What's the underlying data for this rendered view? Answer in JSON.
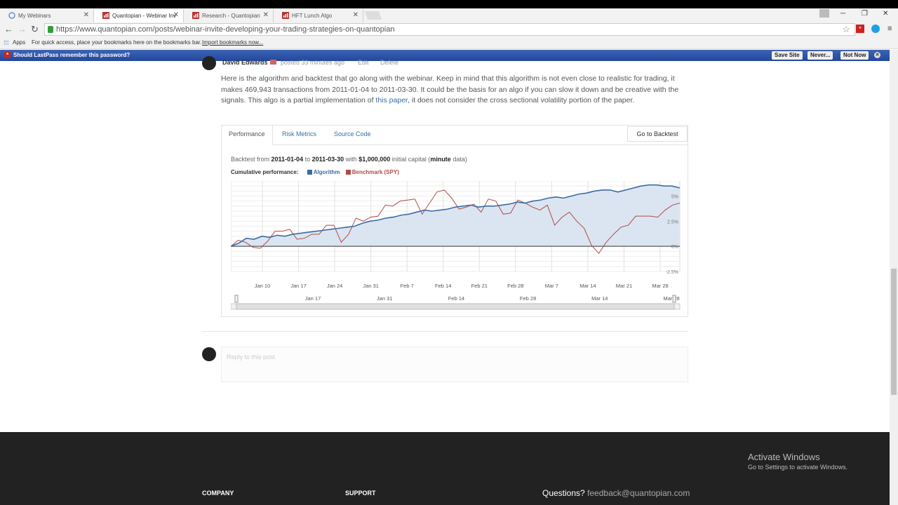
{
  "browser": {
    "tabs": [
      {
        "label": "My Webinars",
        "active": false
      },
      {
        "label": "Quantopian - Webinar Inv",
        "active": true
      },
      {
        "label": "Research - Quantopian",
        "active": false
      },
      {
        "label": "HFT Lunch Algo",
        "active": false
      }
    ],
    "url": "https://www.quantopian.com/posts/webinar-invite-developing-your-trading-strategies-on-quantopian",
    "bookmarks": {
      "apps_label": "Apps",
      "hint": "For quick access, place your bookmarks here on the bookmarks bar.",
      "import_link": "Import bookmarks now..."
    }
  },
  "lastpass": {
    "message": "Should LastPass remember this password?",
    "save_site": "Save Site",
    "never": "Never...",
    "not_now": "Not Now"
  },
  "post": {
    "author": "David Edwards",
    "posted": "posted 33 minutes ago",
    "edit": "Edit",
    "delete": "Delete",
    "text_part1": "Here is the algorithm and backtest that go along with the webinar. Keep in mind that this algorithm is not even close to realistic for trading, it makes 469,943 transactions from 2011-01-04 to 2011-03-30. It could be the basis for an algo if you can slow it down and be creative with the signals. This algo is a partial implementation of ",
    "link_text": "this paper",
    "text_part2": ", it does not consider the cross sectional volatility portion of the paper."
  },
  "backtest": {
    "tabs": {
      "performance": "Performance",
      "risk": "Risk Metrics",
      "source": "Source Code"
    },
    "go_to_backtest": "Go to Backtest",
    "bt_from": "Backtest from",
    "start": "2011-01-04",
    "to": "to",
    "end": "2011-03-30",
    "with": "with",
    "capital": "$1,000,000",
    "initial_capital": "initial capital (",
    "freq": "minute",
    "data_suffix": "data)",
    "cumulative_label": "Cumulative performance:",
    "legend_algo": "Algorithm",
    "legend_bench": "Benchmark (SPY)"
  },
  "reply": {
    "placeholder": "Reply to this post"
  },
  "footer": {
    "company": "COMPANY",
    "support": "SUPPORT",
    "questions": "Questions?",
    "email": "feedback@quantopian.com"
  },
  "windows": {
    "activate": "Activate Windows",
    "activate_sub": "Go to Settings to activate Windows."
  },
  "colors": {
    "algo": "#3b6ba5",
    "bench": "#b04a4a",
    "area": "#dbe5f1",
    "lastpass": "#2b52a8"
  },
  "chart_data": {
    "type": "line",
    "ylim": [
      -2.5,
      6.5
    ],
    "yticks": [
      {
        "v": 5,
        "label": "5%"
      },
      {
        "v": 2.5,
        "label": "2.5%"
      },
      {
        "v": 0,
        "label": "0%"
      },
      {
        "v": -2.5,
        "label": "-2.5%"
      }
    ],
    "xticks": [
      "Jan 10",
      "Jan 17",
      "Jan 24",
      "Jan 31",
      "Feb 7",
      "Feb 14",
      "Feb 21",
      "Feb 28",
      "Mar 7",
      "Mar 14",
      "Mar 21",
      "Mar 28"
    ],
    "navigator_ticks": [
      "Jan 17",
      "Jan 31",
      "Feb 14",
      "Feb 28",
      "Mar 14",
      "Mar 28"
    ],
    "series": [
      {
        "name": "Algorithm",
        "values": [
          0,
          0.3,
          0.8,
          0.7,
          1.0,
          0.9,
          1.1,
          1.0,
          1.2,
          1.3,
          1.4,
          1.5,
          1.6,
          1.7,
          1.8,
          1.9,
          2.0,
          2.3,
          2.5,
          2.6,
          2.8,
          2.9,
          3.1,
          3.2,
          3.4,
          3.6,
          3.5,
          3.6,
          3.7,
          3.9,
          4.0,
          4.1,
          3.9,
          4.0,
          4.0,
          4.1,
          4.2,
          4.4,
          4.3,
          4.5,
          4.6,
          4.8,
          4.9,
          4.8,
          5.0,
          5.2,
          5.3,
          5.5,
          5.6,
          5.6,
          5.4,
          5.6,
          5.8,
          6.0,
          6.1,
          6.1,
          6.0,
          6.0,
          5.8
        ]
      },
      {
        "name": "Benchmark (SPY)",
        "values": [
          0,
          0.6,
          0.4,
          -0.1,
          -0.2,
          0.5,
          1.5,
          1.5,
          1.7,
          0.7,
          0.8,
          1.2,
          1.2,
          2.1,
          2.1,
          0.4,
          1.2,
          2.8,
          2.5,
          2.9,
          3.0,
          4.1,
          4.0,
          4.5,
          4.6,
          4.7,
          3.2,
          4.3,
          5.4,
          5.6,
          4.8,
          3.7,
          3.9,
          4.2,
          3.4,
          4.7,
          4.5,
          3.2,
          3.3,
          4.6,
          4.3,
          3.9,
          3.6,
          4.1,
          2.1,
          2.9,
          3.4,
          2.5,
          1.8,
          0.1,
          -0.7,
          0.4,
          1.2,
          1.9,
          2.1,
          3.0,
          3.0,
          3.0,
          2.9,
          3.6,
          4.1,
          4.3
        ]
      }
    ]
  }
}
